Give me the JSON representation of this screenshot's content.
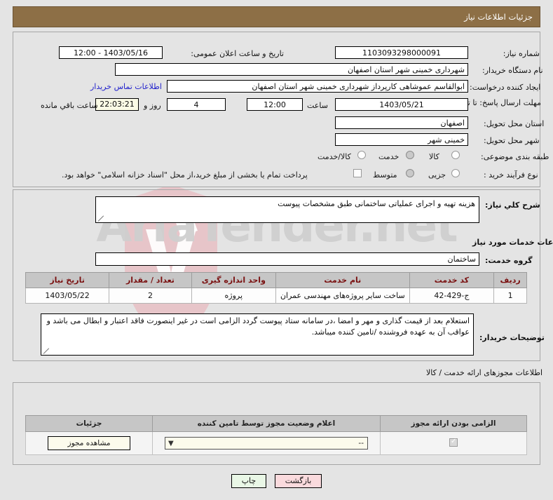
{
  "header": {
    "title": "جزئیات اطلاعات نیاز"
  },
  "watermark": {
    "text": "AriaTender.net"
  },
  "form": {
    "need_number_label": "شماره نیاز:",
    "need_number_value": "1103093298000091",
    "announce_label": "تاریخ و ساعت اعلان عمومی:",
    "announce_value": "1403/05/16 - 12:00",
    "buyer_org_label": "نام دستگاه خریدار:",
    "buyer_org_value": "شهرداری خمینی شهر استان اصفهان",
    "creator_label": "ایجاد کننده درخواست:",
    "creator_value": "ابوالقاسم عموشاهی کارپرداز شهرداری خمینی شهر استان اصفهان",
    "contact_link": "اطلاعات تماس خریدار",
    "deadline_label": "مهلت ارسال پاسخ: تا تاریخ:",
    "deadline_date": "1403/05/21",
    "hour_label": "ساعت",
    "deadline_hour": "12:00",
    "days_value": "4",
    "days_label": "روز و",
    "countdown_value": "22:03:21",
    "remaining_label": "ساعت باقي مانده",
    "province_label": "استان محل تحویل:",
    "province_value": "اصفهان",
    "city_label": "شهر محل تحویل:",
    "city_value": "خمینی شهر",
    "category_label": "طبقه بندی موضوعی:",
    "category_options": [
      {
        "label": "کالا",
        "selected": false
      },
      {
        "label": "خدمت",
        "selected": true
      },
      {
        "label": "کالا/خدمت",
        "selected": false
      }
    ],
    "process_label": "نوع فرآیند خرید :",
    "process_options": [
      {
        "label": "جزیی",
        "selected": false
      },
      {
        "label": "متوسط",
        "selected": true
      }
    ],
    "treasury_checkbox_label": "پرداخت تمام یا بخشی از مبلغ خرید،از محل \"اسناد خزانه اسلامی\" خواهد بود.",
    "treasury_checked": false
  },
  "middle": {
    "summary_label": "شرح كلي نياز:",
    "summary_value": "هزینه تهیه و اجرای عملیاتی ساختمانی طبق مشخصات پیوست",
    "services_info_title": "اطلاعات خدمات مورد نیاز",
    "service_group_label": "گروه خدمت:",
    "service_group_value": "ساختمان",
    "notes_label": "توضیحات خریدار:",
    "notes_value": "استعلام بعد از قیمت گذاری و مهر و امضا ،در سامانه ستاد پیوست گردد الزامی است در غیر اینصورت فاقد اعتبار و ابطال می باشد و عواقب آن به عهده فروشنده /تامین کننده میباشد."
  },
  "items_table": {
    "headers": [
      "ردیف",
      "کد خدمت",
      "نام خدمت",
      "واحد اندازه گیری",
      "تعداد / مقدار",
      "تاریخ نیاز"
    ],
    "rows": [
      [
        "1",
        "ج-429-42",
        "ساخت سایر پروژه‌های مهندسی عمران",
        "پروژه",
        "2",
        "1403/05/22"
      ]
    ]
  },
  "permits": {
    "section_title": "اطلاعات مجوزهای ارائه خدمت / کالا",
    "headers": [
      "الزامی بودن ارائه مجوز",
      "اعلام وضعیت مجوز توسط تامین کننده",
      "جزئیات"
    ],
    "rows": [
      {
        "required": true,
        "status_value": "--",
        "details_button": "مشاهده مجوز"
      }
    ]
  },
  "footer": {
    "print_label": "چاپ",
    "back_label": "بازگشت"
  }
}
